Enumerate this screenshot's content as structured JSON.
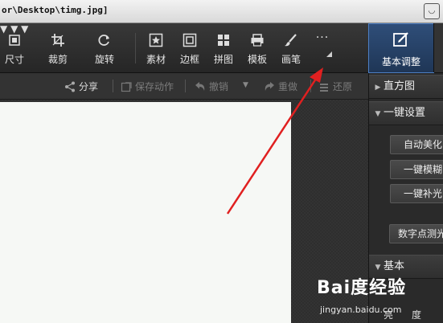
{
  "titlebar": {
    "path": "or\\Desktop\\timg.jpg]"
  },
  "toolbar": {
    "tools": [
      {
        "label": "尺寸"
      },
      {
        "label": "裁剪"
      },
      {
        "label": "旋转"
      },
      {
        "label": "素材"
      },
      {
        "label": "边框"
      },
      {
        "label": "拼图"
      },
      {
        "label": "模板"
      },
      {
        "label": "画笔"
      }
    ],
    "more": "···",
    "active_tab": "基本调整"
  },
  "actions": {
    "share": "分享",
    "save_action": "保存动作",
    "undo": "撤销",
    "redo": "重做",
    "restore": "还原"
  },
  "panel": {
    "histogram": "直方图",
    "oneclick": "一键设置",
    "auto_beautify": "自动美化",
    "oneclick_blur": "一键模糊",
    "oneclick_fill_light": "一键补光",
    "digital_metering": "数字点测光",
    "basic": "基本",
    "bright": "亮",
    "degree": "度"
  },
  "watermark": {
    "brand": "Bai度经验",
    "url": "jingyan.baidu.com"
  },
  "colors": {
    "accent": "#4d7fc4",
    "arrow": "#e02020"
  }
}
